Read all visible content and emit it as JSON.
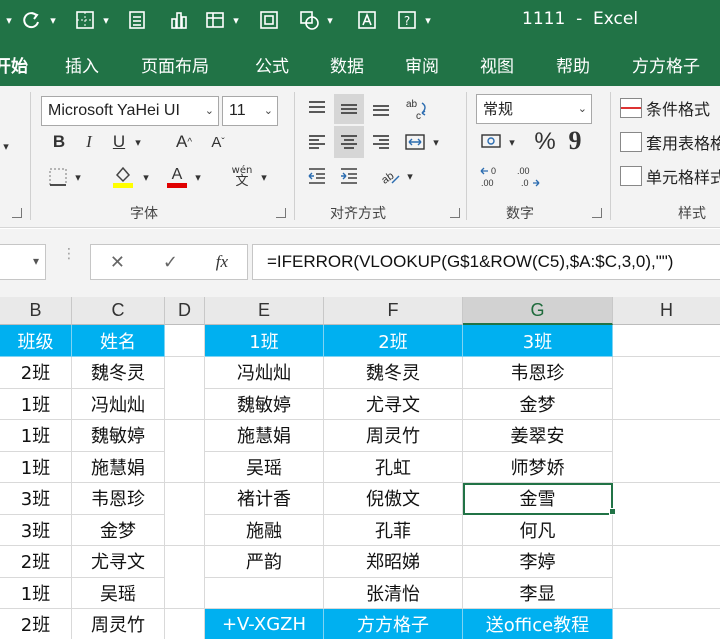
{
  "window": {
    "title": "1111  -  Excel"
  },
  "tabs": [
    "开始",
    "插入",
    "页面布局",
    "公式",
    "数据",
    "审阅",
    "视图",
    "帮助",
    "方方格子"
  ],
  "ribbon": {
    "font_name": "Microsoft YaHei UI",
    "font_size": "11",
    "bold": "B",
    "italic": "I",
    "underline": "U",
    "grow_font": "A",
    "shrink_font": "A",
    "phonetic": "wén",
    "font_group": "字体",
    "align_group": "对齐方式",
    "number_format": "常规",
    "percent": "%",
    "comma": "9",
    "number_group": "数字",
    "cond_format": "条件格式",
    "table_format": "套用表格格式",
    "cell_styles": "单元格样式",
    "styles_group": "样式"
  },
  "formula_bar": {
    "name_box": "",
    "formula": "=IFERROR(VLOOKUP(G$1&ROW(C5),$A:$C,3,0),\"\")",
    "fx": "fx"
  },
  "columns": [
    "B",
    "C",
    "D",
    "E",
    "F",
    "G",
    "H"
  ],
  "selected_column": "G",
  "left_table": {
    "headers": [
      "班级",
      "姓名"
    ],
    "rows": [
      [
        "2班",
        "魏冬灵"
      ],
      [
        "1班",
        "冯灿灿"
      ],
      [
        "1班",
        "魏敏婷"
      ],
      [
        "1班",
        "施慧娟"
      ],
      [
        "3班",
        "韦恩珍"
      ],
      [
        "3班",
        "金梦"
      ],
      [
        "2班",
        "尤寻文"
      ],
      [
        "1班",
        "吴瑶"
      ],
      [
        "2班",
        "周灵竹"
      ]
    ]
  },
  "right_table": {
    "headers": [
      "1班",
      "2班",
      "3班"
    ],
    "rows": [
      [
        "冯灿灿",
        "魏冬灵",
        "韦恩珍"
      ],
      [
        "魏敏婷",
        "尤寻文",
        "金梦"
      ],
      [
        "施慧娟",
        "周灵竹",
        "姜翠安"
      ],
      [
        "吴瑶",
        "孔虹",
        "师梦娇"
      ],
      [
        "褚计香",
        "倪傲文",
        "金雪"
      ],
      [
        "施融",
        "孔菲",
        "何凡"
      ],
      [
        "严韵",
        "郑昭娣",
        "李婷"
      ],
      [
        "",
        "张清怡",
        "李显"
      ]
    ],
    "footer": [
      "+V-XGZH",
      "方方格子",
      "送office教程"
    ]
  },
  "colors": {
    "excel_green": "#217346",
    "header_blue": "#00b0f0"
  }
}
